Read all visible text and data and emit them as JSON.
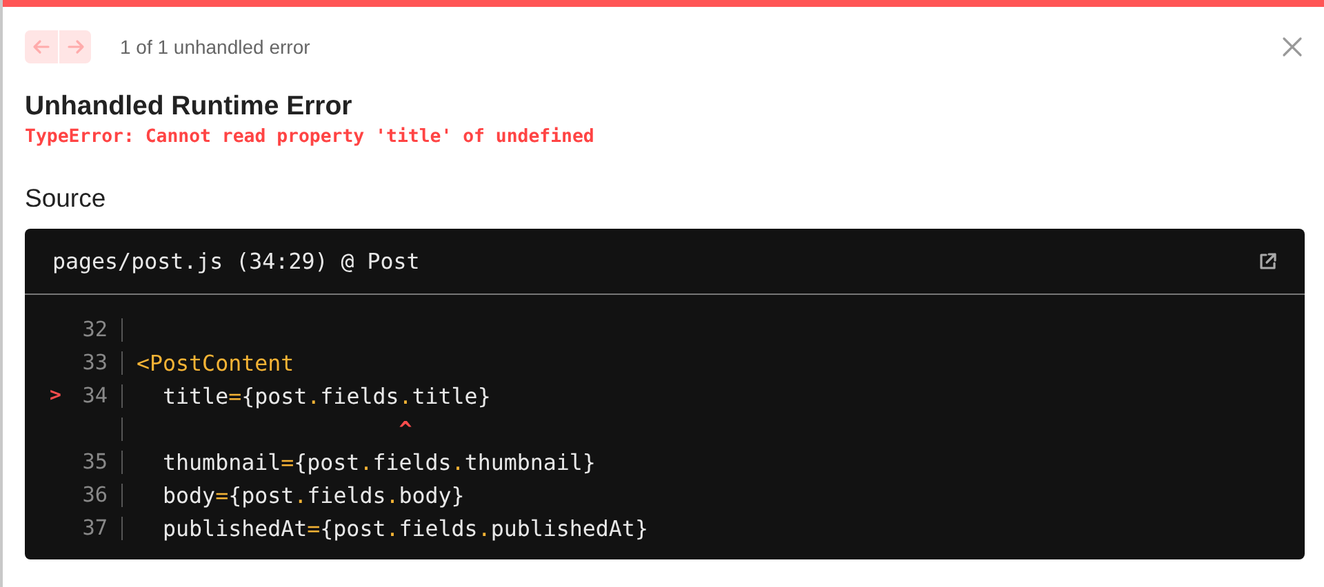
{
  "pager": {
    "prev": {
      "disabled": true
    },
    "next": {
      "disabled": true
    },
    "label": "1 of 1 unhandled error"
  },
  "title": "Unhandled Runtime Error",
  "message": "TypeError: Cannot read property 'title' of undefined",
  "section": "Source",
  "source": {
    "location": "pages/post.js (34:29) @ Post",
    "lines": [
      {
        "kind": "code",
        "number": "32"
      },
      {
        "kind": "code",
        "number": "33",
        "code": [
          {
            "text": "<PostContent",
            "kind": "accent"
          }
        ]
      },
      {
        "kind": "code",
        "number": "34",
        "marker": ">",
        "code": [
          {
            "text": "  title",
            "kind": "plain"
          },
          {
            "text": "=",
            "kind": "accent"
          },
          {
            "text": "{post",
            "kind": "plain"
          },
          {
            "text": ".",
            "kind": "accent"
          },
          {
            "text": "fields",
            "kind": "plain"
          },
          {
            "text": ".",
            "kind": "accent"
          },
          {
            "text": "title}",
            "kind": "plain"
          }
        ]
      },
      {
        "kind": "caret",
        "code": [
          {
            "text": "                    ^",
            "kind": "error"
          }
        ]
      },
      {
        "kind": "code",
        "number": "35",
        "code": [
          {
            "text": "  thumbnail",
            "kind": "plain"
          },
          {
            "text": "=",
            "kind": "accent"
          },
          {
            "text": "{post",
            "kind": "plain"
          },
          {
            "text": ".",
            "kind": "accent"
          },
          {
            "text": "fields",
            "kind": "plain"
          },
          {
            "text": ".",
            "kind": "accent"
          },
          {
            "text": "thumbnail}",
            "kind": "plain"
          }
        ]
      },
      {
        "kind": "code",
        "number": "36",
        "code": [
          {
            "text": "  body",
            "kind": "plain"
          },
          {
            "text": "=",
            "kind": "accent"
          },
          {
            "text": "{post",
            "kind": "plain"
          },
          {
            "text": ".",
            "kind": "accent"
          },
          {
            "text": "fields",
            "kind": "plain"
          },
          {
            "text": ".",
            "kind": "accent"
          },
          {
            "text": "body}",
            "kind": "plain"
          }
        ]
      },
      {
        "kind": "code",
        "number": "37",
        "code": [
          {
            "text": "  publishedAt",
            "kind": "plain"
          },
          {
            "text": "=",
            "kind": "accent"
          },
          {
            "text": "{post",
            "kind": "plain"
          },
          {
            "text": ".",
            "kind": "accent"
          },
          {
            "text": "fields",
            "kind": "plain"
          },
          {
            "text": ".",
            "kind": "accent"
          },
          {
            "text": "publishedAt}",
            "kind": "plain"
          }
        ]
      }
    ]
  }
}
